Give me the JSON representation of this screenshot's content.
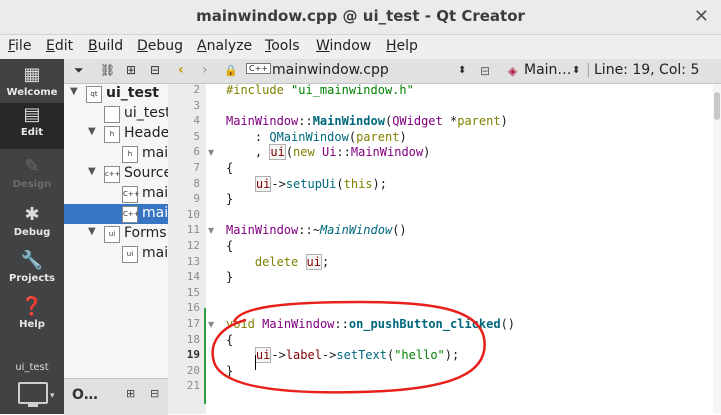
{
  "window": {
    "title": "mainwindow.cpp @ ui_test - Qt Creator",
    "close_glyph": "✕"
  },
  "menu": [
    {
      "underline": "F",
      "rest": "ile"
    },
    {
      "underline": "E",
      "rest": "dit"
    },
    {
      "underline": "B",
      "rest": "uild"
    },
    {
      "underline": "D",
      "rest": "ebug"
    },
    {
      "underline": "A",
      "rest": "nalyze"
    },
    {
      "underline": "T",
      "rest": "ools"
    },
    {
      "underline": "W",
      "rest": "indow"
    },
    {
      "underline": "H",
      "rest": "elp"
    }
  ],
  "modes": [
    {
      "label": "Welcome",
      "icon": "grid-icon",
      "glyph": "▦",
      "state": "normal"
    },
    {
      "label": "Edit",
      "icon": "edit-icon",
      "glyph": "▤",
      "state": "active"
    },
    {
      "label": "Design",
      "icon": "pencil-icon",
      "glyph": "✎",
      "state": "disabled"
    },
    {
      "label": "Debug",
      "icon": "bug-icon",
      "glyph": "✱",
      "state": "normal"
    },
    {
      "label": "Projects",
      "icon": "wrench-icon",
      "glyph": "🔧",
      "state": "normal"
    },
    {
      "label": "Help",
      "icon": "help-icon",
      "glyph": "❓",
      "state": "normal"
    }
  ],
  "kit": {
    "label": "ui_test"
  },
  "sidebar_toolbar": {
    "filter_icon": "⏷",
    "link_icon": "⛓",
    "split_icon": "⊞",
    "close_icon": "⊟"
  },
  "tree": [
    {
      "label": "ui_test",
      "icon": "project-icon",
      "icon_text": "qt",
      "arrow": "▼",
      "bold": true
    },
    {
      "label": "ui_test",
      "icon": "pro-file-icon",
      "icon_text": "",
      "arrow": ""
    },
    {
      "label": "Headers",
      "icon": "headers-folder-icon",
      "icon_text": "h",
      "arrow": "▼"
    },
    {
      "label": "mainwindow.h",
      "icon": "header-file-icon",
      "icon_text": "h",
      "arrow": ""
    },
    {
      "label": "Sources",
      "icon": "sources-folder-icon",
      "icon_text": "c++",
      "arrow": "▼"
    },
    {
      "label": "main.cpp",
      "icon": "cpp-file-icon",
      "icon_text": "C++",
      "arrow": ""
    },
    {
      "label": "mainwindow.cpp",
      "icon": "cpp-file-icon",
      "icon_text": "C++",
      "arrow": "",
      "selected": true
    },
    {
      "label": "Forms",
      "icon": "forms-folder-icon",
      "icon_text": "ui",
      "arrow": "▼"
    },
    {
      "label": "mainwindow.ui",
      "icon": "ui-file-icon",
      "icon_text": "ui",
      "arrow": ""
    }
  ],
  "outline_panel": {
    "label": "O…",
    "split_icon": "⊞",
    "close_icon": "⊟"
  },
  "editor_toolbar": {
    "back": "‹",
    "forward": "›",
    "lock": "🔒",
    "file_badge": "C++",
    "filename": "mainwindow.cpp",
    "symbol": "Main…",
    "position": "Line: 19, Col: 5"
  },
  "code": [
    {
      "n": "2",
      "html": "<span class='kw'>#include</span> <span class='str'>\"ui_mainwindow.h\"</span>"
    },
    {
      "n": "3",
      "html": ""
    },
    {
      "n": "4",
      "html": "<span class='cls'>MainWindow</span>::<span class='fnb'>MainWindow</span>(<span class='cls'>QWidget</span> *<span class='kw'>parent</span>)"
    },
    {
      "n": "5",
      "html": "    : <span class='fn'>QMainWindow</span>(<span class='kw'>parent</span>)"
    },
    {
      "n": "6",
      "html": "    , <span class='mem boxed'>ui</span>(<span class='kw'>new</span> <span class='cls'>Ui</span>::<span class='cls'>MainWindow</span>)",
      "fold": true
    },
    {
      "n": "7",
      "html": "{"
    },
    {
      "n": "8",
      "html": "    <span class='mem boxed'>ui</span>-><span class='fn'>setupUi</span>(<span class='kw'>this</span>);"
    },
    {
      "n": "9",
      "html": "}"
    },
    {
      "n": "10",
      "html": ""
    },
    {
      "n": "11",
      "html": "<span class='cls'>MainWindow</span>::~<span class='ital'>MainWindow</span>()",
      "fold": true
    },
    {
      "n": "12",
      "html": "{"
    },
    {
      "n": "13",
      "html": "    <span class='kw'>delete</span> <span class='mem boxed'>ui</span>;"
    },
    {
      "n": "14",
      "html": "}"
    },
    {
      "n": "15",
      "html": ""
    },
    {
      "n": "16",
      "html": ""
    },
    {
      "n": "17",
      "html": "<span class='kw'>void</span> <span class='cls'>MainWindow</span>::<span class='fnb'>on_pushButton_clicked</span>()",
      "fold": true
    },
    {
      "n": "18",
      "html": "{"
    },
    {
      "n": "19",
      "html": "    <span class='mem boxed'>ui</span>-><span class='mem'>label</span>-><span class='fn'>setText</span>(<span class='str'>\"hello\"</span>);",
      "current": true
    },
    {
      "n": "20",
      "html": "}"
    },
    {
      "n": "21",
      "html": ""
    }
  ],
  "annotation_color": "#e8201c"
}
